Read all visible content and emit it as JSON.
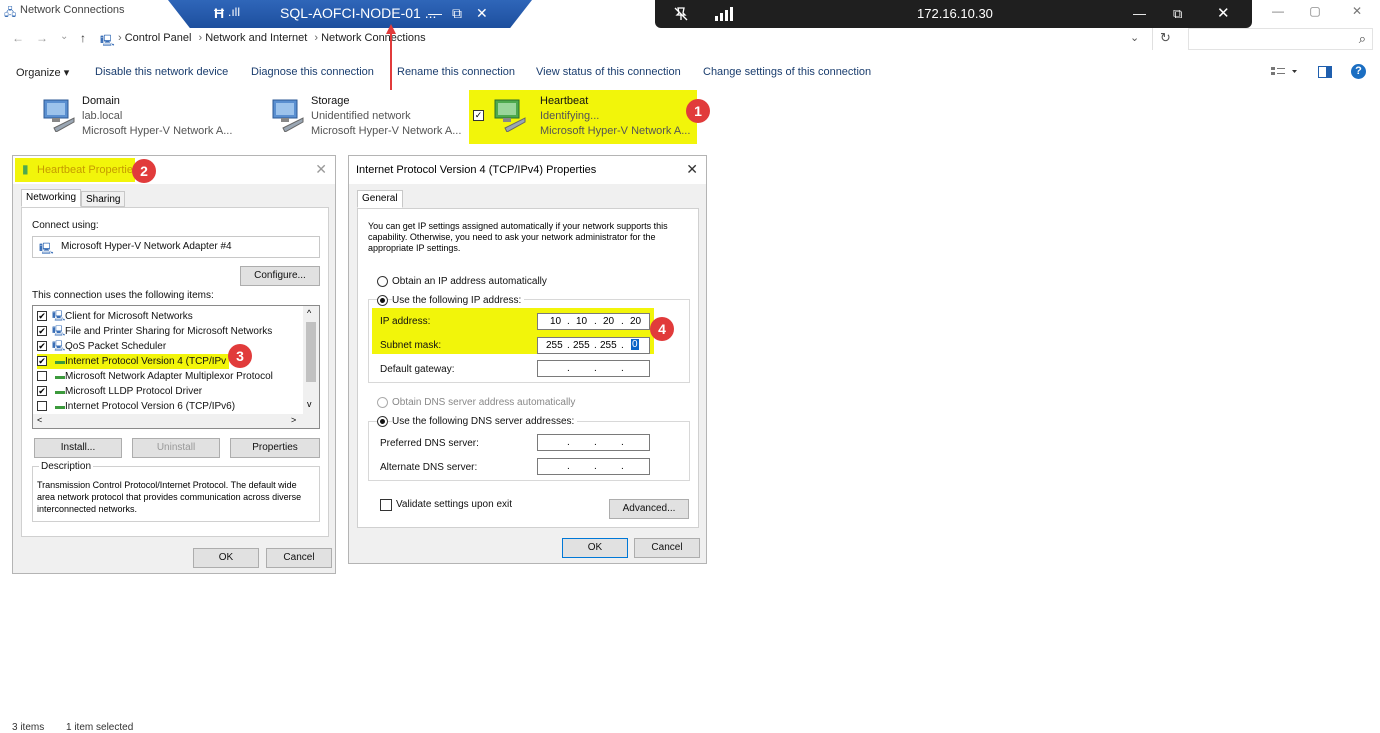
{
  "window": {
    "title": "Network Connections",
    "min": "—",
    "max": "▢",
    "close": "✕"
  },
  "rdp_banner": {
    "pin": "Ħ",
    "signal": ".ıll",
    "title": "SQL-AOFCI-NODE-01 ...",
    "min": "—",
    "restore": "⧉",
    "close": "✕"
  },
  "remote_bar": {
    "host": "172.16.10.30",
    "min": "—",
    "restore": "⧉",
    "close": "✕"
  },
  "address": {
    "back": "←",
    "forward": "→",
    "recent": "⌄",
    "up": "↑",
    "crumbs": [
      "Control Panel",
      "Network and Internet",
      "Network Connections"
    ],
    "sep": "›",
    "dropdown": "⌄",
    "refresh": "↻",
    "search": "⌕"
  },
  "commands": {
    "organize": "Organize ▾",
    "disable": "Disable this network device",
    "diagnose": "Diagnose this connection",
    "rename": "Rename this connection",
    "status": "View status of this connection",
    "change": "Change settings of this connection",
    "help": "?"
  },
  "adapters": [
    {
      "name": "Domain",
      "status": "lab.local",
      "device": "Microsoft Hyper-V Network A..."
    },
    {
      "name": "Storage",
      "status": "Unidentified network",
      "device": "Microsoft Hyper-V Network A..."
    },
    {
      "name": "Heartbeat",
      "status": "Identifying...",
      "device": "Microsoft Hyper-V Network A..."
    }
  ],
  "badges": {
    "b1": "1",
    "b2": "2",
    "b3": "3",
    "b4": "4"
  },
  "props_dialog": {
    "title": "Heartbeat Properties",
    "close": "✕",
    "tabs": [
      "Networking",
      "Sharing"
    ],
    "connect_using_label": "Connect using:",
    "adapter": "Microsoft Hyper-V Network Adapter #4",
    "configure": "Configure...",
    "items_label": "This connection uses the following items:",
    "items": [
      {
        "label": "Client for Microsoft Networks",
        "checked": "✔"
      },
      {
        "label": "File and Printer Sharing for Microsoft Networks",
        "checked": "✔"
      },
      {
        "label": "QoS Packet Scheduler",
        "checked": "✔"
      },
      {
        "label": "Internet Protocol Version 4 (TCP/IPv",
        "checked": "✔"
      },
      {
        "label": "Microsoft Network Adapter Multiplexor Protocol",
        "checked": ""
      },
      {
        "label": "Microsoft LLDP Protocol Driver",
        "checked": "✔"
      },
      {
        "label": "Internet Protocol Version 6 (TCP/IPv6)",
        "checked": ""
      }
    ],
    "scroll_left": "<",
    "scroll_right": ">",
    "scroll_up": "^",
    "scroll_down": "v",
    "install": "Install...",
    "uninstall": "Uninstall",
    "properties": "Properties",
    "description_label": "Description",
    "description": "Transmission Control Protocol/Internet Protocol. The default wide area network protocol that provides communication across diverse interconnected networks.",
    "ok": "OK",
    "cancel": "Cancel"
  },
  "ipv4_dialog": {
    "title": "Internet Protocol Version 4 (TCP/IPv4) Properties",
    "close": "✕",
    "tab": "General",
    "intro": "You can get IP settings assigned automatically if your network supports this capability. Otherwise, you need to ask your network administrator for the appropriate IP settings.",
    "obtain_ip": "Obtain an IP address automatically",
    "use_ip": "Use the following IP address:",
    "ip_label": "IP address:",
    "ip_value": [
      "10",
      "10",
      "20",
      "20"
    ],
    "mask_label": "Subnet mask:",
    "mask_value": [
      "255",
      "255",
      "255",
      "0"
    ],
    "gateway_label": "Default gateway:",
    "dot": ".",
    "obtain_dns": "Obtain DNS server address automatically",
    "use_dns": "Use the following DNS server addresses:",
    "preferred_dns": "Preferred DNS server:",
    "alternate_dns": "Alternate DNS server:",
    "validate": "Validate settings upon exit",
    "advanced": "Advanced...",
    "ok": "OK",
    "cancel": "Cancel"
  },
  "status_bar": {
    "items": "3 items",
    "selected": "1 item selected"
  },
  "colors": {
    "highlight": "#f2f50a",
    "badge": "#e13b3b",
    "rdp_blue": "#2f66b9",
    "arrow": "#e13b3b"
  }
}
